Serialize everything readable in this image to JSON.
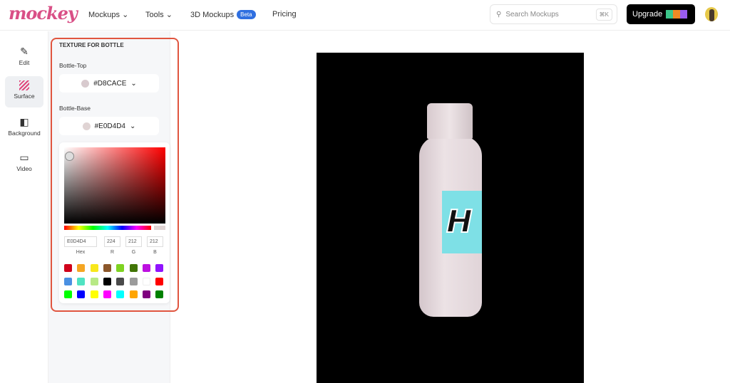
{
  "header": {
    "logo": "mockey",
    "nav": [
      {
        "label": "Mockups ⌄"
      },
      {
        "label": "Tools ⌄"
      },
      {
        "label": "3D Mockups",
        "badge": "Beta"
      },
      {
        "label": "Pricing"
      }
    ],
    "search": {
      "placeholder": "Search Mockups",
      "shortcut": "⌘K"
    },
    "upgrade_label": "Upgrade"
  },
  "rail": [
    {
      "label": "Edit",
      "icon": "pencil-icon"
    },
    {
      "label": "Surface",
      "icon": "texture-icon",
      "active": true
    },
    {
      "label": "Background",
      "icon": "background-icon"
    },
    {
      "label": "Video",
      "icon": "video-icon"
    }
  ],
  "panel": {
    "title": "TEXTURE FOR BOTTLE",
    "parts": [
      {
        "label": "Bottle-Top",
        "value": "#D8CACE",
        "color": "#D8CACE"
      },
      {
        "label": "Bottle-Base",
        "value": "#E0D4D4",
        "color": "#E0D4D4"
      }
    ],
    "picker": {
      "hex": "E0D4D4",
      "r": "224",
      "g": "212",
      "b": "212",
      "labels": {
        "hex": "Hex",
        "r": "R",
        "g": "G",
        "b": "B"
      },
      "swatches": [
        "#d0021b",
        "#f5a623",
        "#f8e71c",
        "#8b572a",
        "#7ed321",
        "#417505",
        "#bd10e0",
        "#9013fe",
        "#4a90e2",
        "#50e3c2",
        "#b8e986",
        "#000000",
        "#4a4a4a",
        "#9b9b9b",
        "#ffffff",
        "#ff0000",
        "#00ff00",
        "#0000ff",
        "#ffff00",
        "#ff00ff",
        "#00ffff",
        "#ffa500",
        "#800080",
        "#008000"
      ]
    }
  },
  "canvas": {
    "label_text": "H"
  }
}
